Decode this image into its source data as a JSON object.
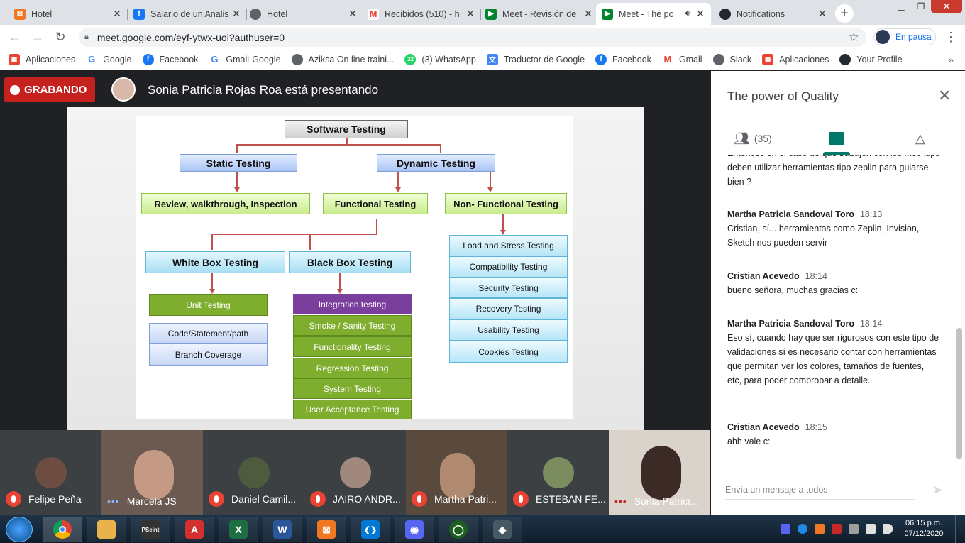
{
  "tabs": [
    {
      "title": "Hotel",
      "icon": "xampp-icon",
      "color": "#f07822",
      "active": false
    },
    {
      "title": "Salario de un Analis",
      "icon": "facebook-icon",
      "color": "#1877f2",
      "active": false
    },
    {
      "title": "Hotel",
      "icon": "globe-icon",
      "color": "#5f6368",
      "active": false
    },
    {
      "title": "Recibidos (510) - h",
      "icon": "gmail-icon",
      "color": "#ea4335",
      "active": false
    },
    {
      "title": "Meet - Revisión de",
      "icon": "meet-icon",
      "color": "#00832d",
      "active": false
    },
    {
      "title": "Meet - The po",
      "icon": "meet-icon",
      "color": "#00832d",
      "active": true
    },
    {
      "title": "Notifications",
      "icon": "github-icon",
      "color": "#24292e",
      "active": false
    }
  ],
  "address": {
    "url": "meet.google.com/eyf-ytwx-uoi?authuser=0"
  },
  "profile": {
    "label": "En pausa"
  },
  "bookmarks": [
    {
      "label": "Aplicaciones",
      "icon": "apps-grid-icon",
      "color": "#ea4335"
    },
    {
      "label": "Google",
      "icon": "google-icon",
      "color": "#4285f4"
    },
    {
      "label": "Facebook",
      "icon": "facebook-icon",
      "color": "#1877f2"
    },
    {
      "label": "Gmail-Google",
      "icon": "google-icon",
      "color": "#4285f4"
    },
    {
      "label": "Aziksa On line traini...",
      "icon": "globe-icon",
      "color": "#5f6368"
    },
    {
      "label": "(3) WhatsApp",
      "icon": "whatsapp-icon",
      "color": "#25d366"
    },
    {
      "label": "Traductor de Google",
      "icon": "translate-icon",
      "color": "#4285f4"
    },
    {
      "label": "Facebook",
      "icon": "facebook-icon",
      "color": "#1877f2"
    },
    {
      "label": "Gmail",
      "icon": "gmail-icon",
      "color": "#ea4335"
    },
    {
      "label": "Slack",
      "icon": "globe-icon",
      "color": "#5f6368"
    },
    {
      "label": "Aplicaciones",
      "icon": "apps-grid-icon",
      "color": "#ea4335"
    },
    {
      "label": "Your Profile",
      "icon": "github-icon",
      "color": "#24292e"
    }
  ],
  "meet": {
    "recording_label": "GRABANDO",
    "presenter_text": "Sonia Patricia Rojas Roa está presentando"
  },
  "diagram": {
    "root": "Software Testing",
    "static": "Static Testing",
    "dynamic": "Dynamic Testing",
    "review": "Review, walkthrough, Inspection",
    "functional": "Functional Testing",
    "nonfunctional": "Non- Functional Testing",
    "whitebox": "White Box Testing",
    "blackbox": "Black Box Testing",
    "unit": "Unit Testing",
    "code": "Code/Statement/path",
    "branch": "Branch Coverage",
    "black_items": [
      "Integration testing",
      "Smoke / Sanity Testing",
      "Functionality Testing",
      "Regression Testing",
      "System Testing",
      "User Acceptance Testing"
    ],
    "nonfunc_items": [
      "Load and Stress Testing",
      "Compatibility Testing",
      "Security Testing",
      "Recovery Testing",
      "Usability Testing",
      "Cookies Testing"
    ]
  },
  "participants": [
    {
      "name": "Felipe Peña",
      "muted": true
    },
    {
      "name": "Marcela JS",
      "muted": false
    },
    {
      "name": "Daniel Camil...",
      "muted": true
    },
    {
      "name": "JAIRO ANDR...",
      "muted": true
    },
    {
      "name": "Martha Patri...",
      "muted": true
    },
    {
      "name": "ESTEBAN FE...",
      "muted": true
    },
    {
      "name": "Sonia Patrici...",
      "muted": false
    }
  ],
  "panel": {
    "title": "The power of Quality",
    "people_count": "(35)",
    "messages": [
      {
        "author": "",
        "time": "",
        "text": "Entonces en el caso de que trabajen con los mockups deben utilizar herramientas tipo zeplin para guiarse bien ?"
      },
      {
        "author": "Martha Patricia Sandoval Toro",
        "time": "18:13",
        "text": "Cristian, sí... herramientas como Zeplin, Invision, Sketch nos pueden servir"
      },
      {
        "author": "Cristian Acevedo",
        "time": "18:14",
        "text": "bueno señora, muchas gracias c:"
      },
      {
        "author": "Martha Patricia Sandoval Toro",
        "time": "18:14",
        "text": "Eso sí, cuando hay que ser rigurosos con este tipo de validaciones sí es necesario contar con herramientas que permitan ver los colores, tamaños de fuentes, etc, para poder comprobar a detalle."
      },
      {
        "author": "Cristian Acevedo",
        "time": "18:15",
        "text": "ahh vale c:"
      }
    ],
    "input_placeholder": "Envía un mensaje a todos"
  },
  "taskbar": {
    "apps": [
      {
        "name": "chrome-app",
        "color": "#db4437",
        "glyph": ""
      },
      {
        "name": "explorer-app",
        "color": "#e8b34a",
        "glyph": ""
      },
      {
        "name": "psint-app",
        "color": "#333333",
        "glyph": "PSeInt"
      },
      {
        "name": "acrobat-app",
        "color": "#d32f2f",
        "glyph": "A"
      },
      {
        "name": "excel-app",
        "color": "#1d6f42",
        "glyph": "X"
      },
      {
        "name": "word-app",
        "color": "#2b579a",
        "glyph": "W"
      },
      {
        "name": "xampp-app",
        "color": "#f07822",
        "glyph": "⊠"
      },
      {
        "name": "vscode-app",
        "color": "#0078d4",
        "glyph": "❮❯"
      },
      {
        "name": "discord-app",
        "color": "#5865f2",
        "glyph": "◉"
      },
      {
        "name": "greenshot-app",
        "color": "#1b5e20",
        "glyph": "◯"
      },
      {
        "name": "git-app",
        "color": "#455a64",
        "glyph": "◆"
      }
    ],
    "time": "06:15 p.m.",
    "date": "07/12/2020"
  }
}
